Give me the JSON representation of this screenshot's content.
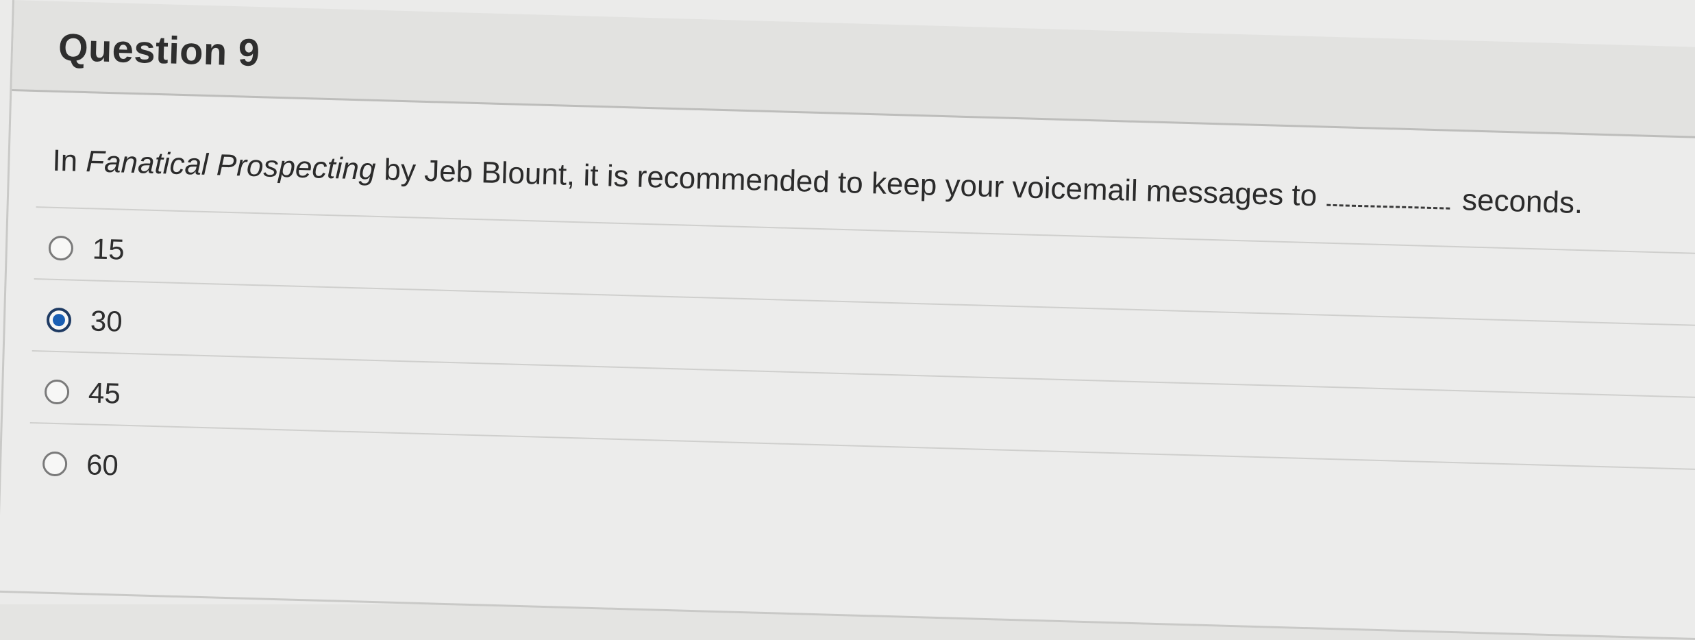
{
  "question": {
    "title": "Question 9",
    "text_before_italic": "In ",
    "text_italic": "Fanatical Prospecting",
    "text_after_italic": " by Jeb Blount, it is recommended to keep your voicemail messages to",
    "text_end": "seconds."
  },
  "answers": [
    {
      "label": "15",
      "selected": false
    },
    {
      "label": "30",
      "selected": true
    },
    {
      "label": "45",
      "selected": false
    },
    {
      "label": "60",
      "selected": false
    }
  ],
  "colors": {
    "selected_radio": "#1a5fb4",
    "background": "#ececeb"
  }
}
